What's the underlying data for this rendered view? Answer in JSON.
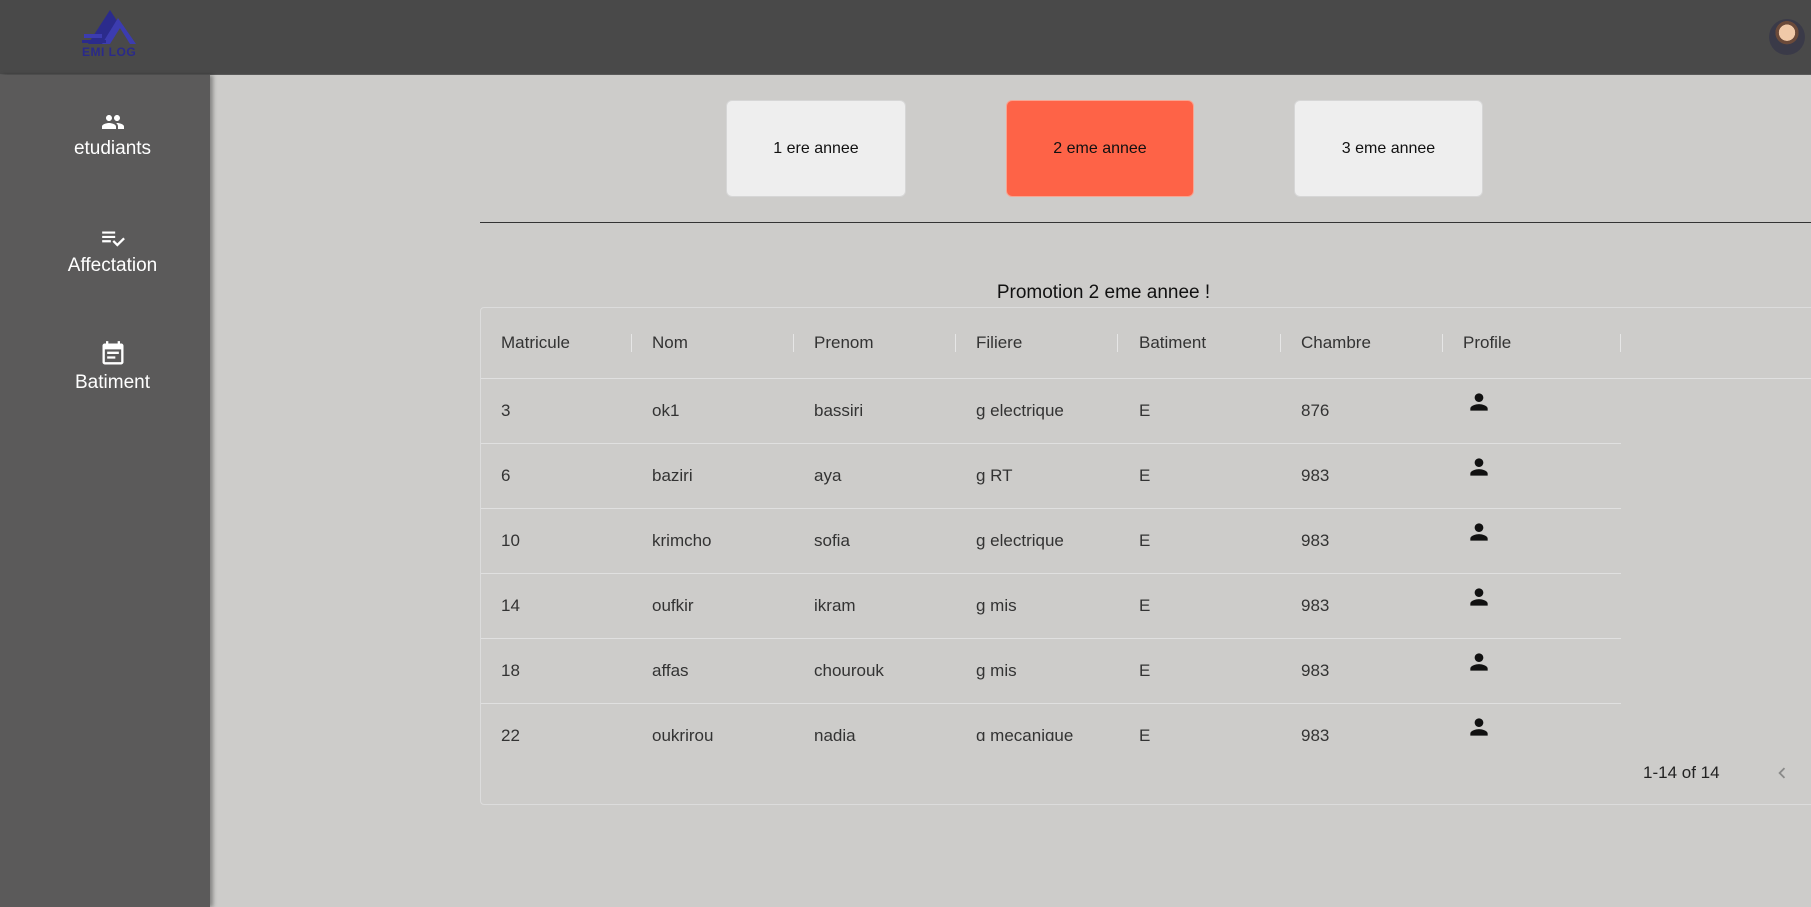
{
  "header": {
    "logo_text": "EMI LOG"
  },
  "sidebar": {
    "items": [
      {
        "label": "etudiants",
        "icon": "people-icon"
      },
      {
        "label": "Affectation",
        "icon": "playlist-check-icon"
      },
      {
        "label": "Batiment",
        "icon": "calendar-icon"
      }
    ]
  },
  "years": [
    {
      "label": "1 ere annee",
      "active": false
    },
    {
      "label": "2 eme annee",
      "active": true
    },
    {
      "label": "3 eme annee",
      "active": false
    }
  ],
  "colors": {
    "accent": "#fe6347",
    "sidebar": "#5b5a5a",
    "topbar": "#494949",
    "background": "#cdccca"
  },
  "table": {
    "title": "Promotion 2 eme annee !",
    "columns": [
      "Matricule",
      "Nom",
      "Prenom",
      "Filiere",
      "Batiment",
      "Chambre",
      "Profile"
    ],
    "rows": [
      [
        "3",
        "ok1",
        "bassiri",
        "g electrique",
        "E",
        "876"
      ],
      [
        "6",
        "baziri",
        "aya",
        "g RT",
        "E",
        "983"
      ],
      [
        "10",
        "krimcho",
        "sofia",
        "g electrique",
        "E",
        "983"
      ],
      [
        "14",
        "oufkir",
        "ikram",
        "g mis",
        "E",
        "983"
      ],
      [
        "18",
        "affas",
        "chourouk",
        "g mis",
        "E",
        "983"
      ],
      [
        "22",
        "oukrirou",
        "nadia",
        "g mecanique",
        "E",
        "983"
      ]
    ],
    "pagination": "1-14 of 14",
    "profile_icon": "person-icon"
  }
}
